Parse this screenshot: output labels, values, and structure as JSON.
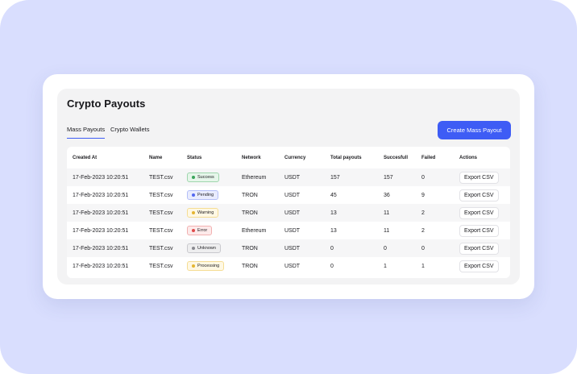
{
  "page": {
    "title": "Crypto Payouts",
    "tabs": [
      {
        "label": "Mass Payouts",
        "active": true
      },
      {
        "label": "Crypto Wallets",
        "active": false
      }
    ],
    "create_button_label": "Create Mass Payout"
  },
  "colors": {
    "accent": "#3e5cf5",
    "background": "#d9defe",
    "status": {
      "Success": {
        "bg": "#e6f6ea",
        "border": "#9fd6ad",
        "dot": "#3aa55a"
      },
      "Pending": {
        "bg": "#e9ecfe",
        "border": "#b4bff8",
        "dot": "#5368f0"
      },
      "Warning": {
        "bg": "#fff8e4",
        "border": "#f5dd94",
        "dot": "#e5b531"
      },
      "Error": {
        "bg": "#fdeaea",
        "border": "#f2b1b1",
        "dot": "#e04a4a"
      },
      "Unknown": {
        "bg": "#eeeeef",
        "border": "#c9c9ce",
        "dot": "#8a8a90"
      },
      "Processing": {
        "bg": "#fff8e4",
        "border": "#f5dd94",
        "dot": "#e5b531"
      }
    }
  },
  "table": {
    "columns": [
      "Created At",
      "Name",
      "Status",
      "Network",
      "Currency",
      "Total payouts",
      "Succesfull",
      "Failed",
      "Actions"
    ],
    "rows": [
      {
        "created_at": "17-Feb-2023 10:20:51",
        "name": "TEST.csv",
        "status": "Success",
        "network": "Ethereum",
        "currency": "USDT",
        "total": "157",
        "success": "157",
        "failed": "0",
        "action": "Export CSV"
      },
      {
        "created_at": "17-Feb-2023 10:20:51",
        "name": "TEST.csv",
        "status": "Pending",
        "network": "TRON",
        "currency": "USDT",
        "total": "45",
        "success": "36",
        "failed": "9",
        "action": "Export CSV"
      },
      {
        "created_at": "17-Feb-2023 10:20:51",
        "name": "TEST.csv",
        "status": "Warning",
        "network": "TRON",
        "currency": "USDT",
        "total": "13",
        "success": "11",
        "failed": "2",
        "action": "Export CSV"
      },
      {
        "created_at": "17-Feb-2023 10:20:51",
        "name": "TEST.csv",
        "status": "Error",
        "network": "Ethereum",
        "currency": "USDT",
        "total": "13",
        "success": "11",
        "failed": "2",
        "action": "Export CSV"
      },
      {
        "created_at": "17-Feb-2023 10:20:51",
        "name": "TEST.csv",
        "status": "Unknown",
        "network": "TRON",
        "currency": "USDT",
        "total": "0",
        "success": "0",
        "failed": "0",
        "action": "Export CSV"
      },
      {
        "created_at": "17-Feb-2023 10:20:51",
        "name": "TEST.csv",
        "status": "Processing",
        "network": "TRON",
        "currency": "USDT",
        "total": "0",
        "success": "1",
        "failed": "1",
        "action": "Export CSV"
      }
    ]
  }
}
